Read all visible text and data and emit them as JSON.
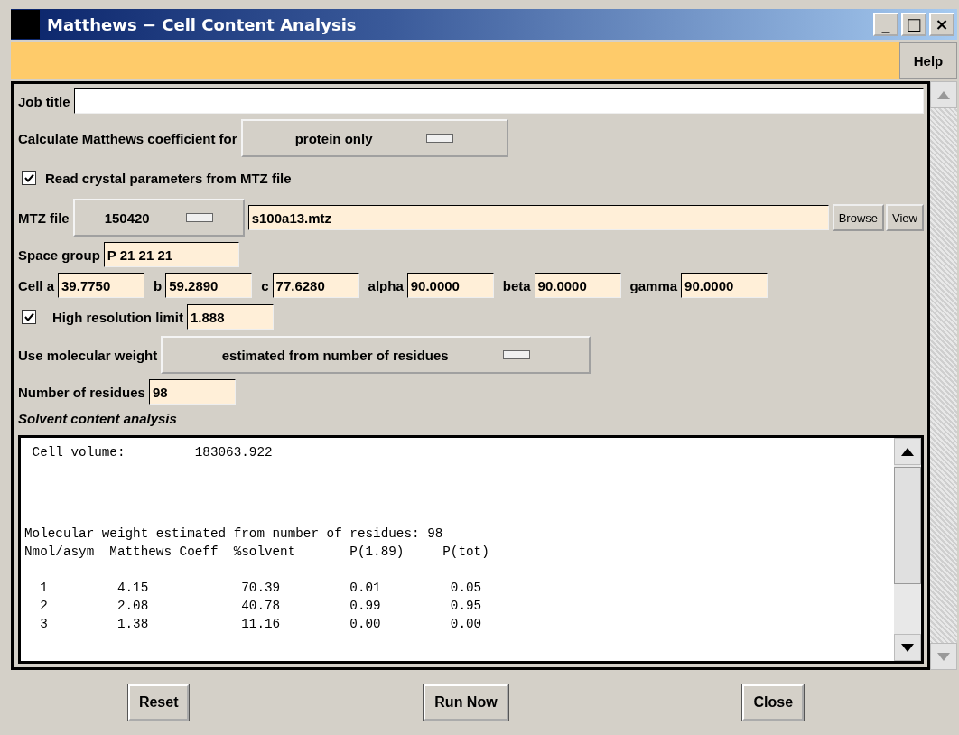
{
  "window": {
    "title": "Matthews − Cell Content Analysis",
    "controls": [
      "_",
      "□",
      "×"
    ]
  },
  "menu_bar": {
    "help": "Help"
  },
  "job_title": {
    "label": "Job title"
  },
  "calculate_for": {
    "label": "Calculate Matthews coefficient for",
    "value": "protein only"
  },
  "read_from_mtz": {
    "label": "Read crystal parameters from MTZ file",
    "checked": true
  },
  "mtz_file": {
    "label": "MTZ file",
    "project": "150420",
    "value": "s100a13.mtz",
    "buttons": [
      "Browse",
      "View"
    ]
  },
  "space_group": {
    "label": "Space group",
    "value": "P 21 21 21"
  },
  "cell": [
    {
      "label": "Cell a",
      "value": "39.7750"
    },
    {
      "label": "b",
      "value": "59.2890"
    },
    {
      "label": "c",
      "value": "77.6280"
    },
    {
      "label": "alpha",
      "value": "90.0000"
    },
    {
      "label": "beta",
      "value": "90.0000"
    },
    {
      "label": "gamma",
      "value": "90.0000"
    }
  ],
  "high_resolution": {
    "label": "High resolution limit",
    "value": "1.888",
    "checked": true
  },
  "molecular_weight": {
    "label": "Use molecular weight",
    "value": "estimated from number of residues"
  },
  "residues": {
    "label": "Number of residues",
    "value": "98"
  },
  "section_title": "Solvent content analysis",
  "output": {
    "blocks": [
      {
        "lines": [
          " Cell volume:         183063.922"
        ]
      },
      {
        "lines": [
          "Molecular weight estimated from number of residues: 98",
          "Nmol/asym  Matthews Coeff  %solvent       P(1.89)     P(tot)"
        ]
      },
      {
        "lines": [
          "  1         4.15            70.39         0.01         0.05",
          "  2         2.08            40.78         0.99         0.95",
          "  3         1.38            11.16         0.00         0.00"
        ]
      }
    ]
  },
  "buttons": [
    "Reset",
    "Run Now",
    "Close"
  ]
}
